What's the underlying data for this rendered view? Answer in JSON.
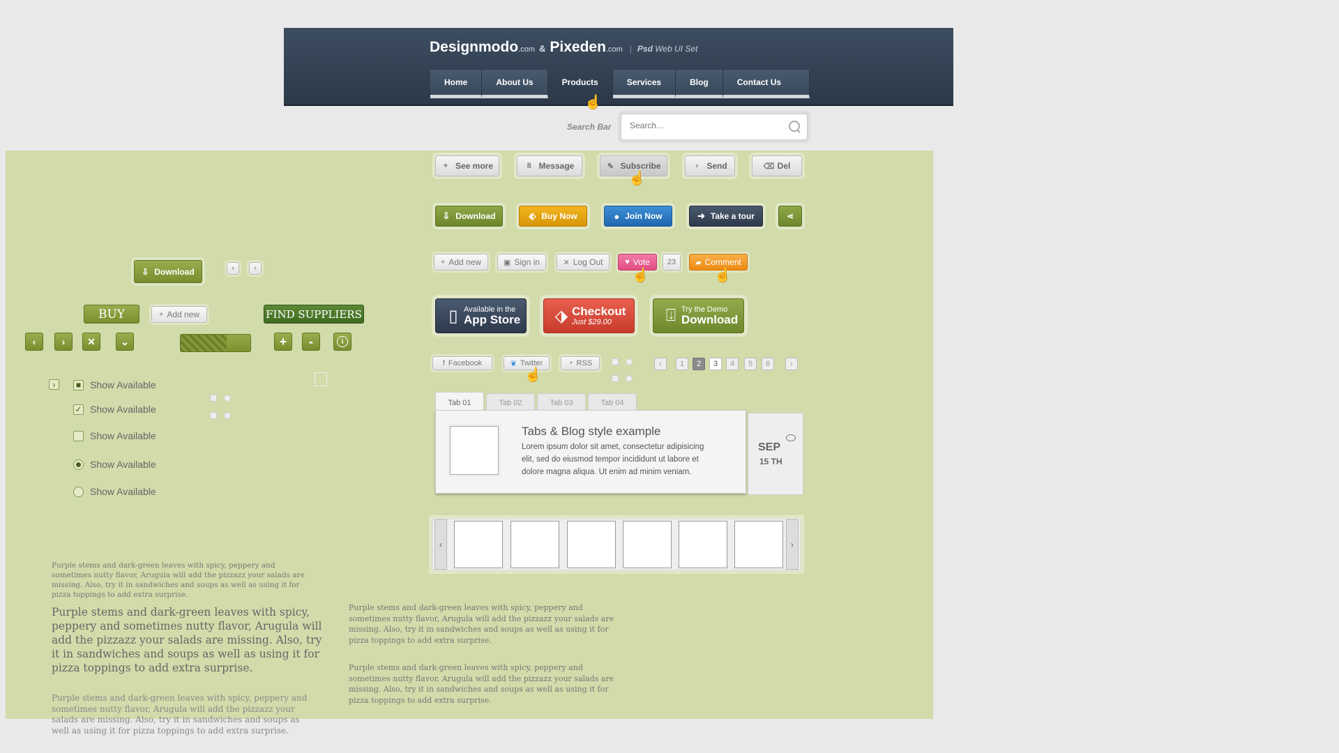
{
  "header": {
    "brand1": "Designmodo",
    "brand1_suffix": ".com",
    "amp": "&",
    "brand2": "Pixeden",
    "brand2_suffix": ".com",
    "divider": "|",
    "psd": "Psd",
    "subtitle": "Web UI Set",
    "nav": [
      "Home",
      "About Us",
      "Products",
      "Services",
      "Blog",
      "Contact Us"
    ],
    "active_nav": "Products"
  },
  "search": {
    "label": "Search Bar",
    "placeholder": "Search..."
  },
  "row1": [
    "See more",
    "Message",
    "Subscribe",
    "Send",
    "Del"
  ],
  "row1_badge": "8",
  "row2": [
    "Download",
    "Buy Now",
    "Join Now",
    "Take a tour"
  ],
  "row3": {
    "add": "Add new",
    "signin": "Sign in",
    "logout": "Log Out",
    "vote": "Vote",
    "count": "23",
    "comment": "Comment"
  },
  "big": {
    "appstore_l1": "Available in the",
    "appstore_l2": "App Store",
    "checkout_l1": "Checkout",
    "checkout_l2": "Just $29.00",
    "demo_l1": "Try the Demo",
    "demo_l2": "Download"
  },
  "social": [
    "Facebook",
    "Twitter",
    "RSS"
  ],
  "pager": {
    "prev": "‹",
    "next": "›",
    "pages": [
      "1",
      "2",
      "3",
      "4",
      "5",
      "6"
    ]
  },
  "tabs": [
    "Tab 01",
    "Tab 02",
    "Tab 03",
    "Tab 04"
  ],
  "blog": {
    "title": "Tabs & Blog style example",
    "text": "Lorem ipsum dolor sit amet, consectetur adipisicing elit, sed do eiusmod tempor incididunt ut labore et dolore magna aliqua. Ut enim ad minim veniam.",
    "month": "SEP",
    "day": "15 TH"
  },
  "left": {
    "download": "Download",
    "buy": "BUY",
    "add_new": "Add new",
    "find": "FIND SUPPLIERS",
    "plus": "+",
    "minus": "-",
    "info": "i",
    "checks": [
      "Show Available",
      "Show Available",
      "Show Available",
      "Show Available",
      "Show Available"
    ]
  },
  "paragraph": "Purple stems and dark-green leaves with spicy, peppery and sometimes nutty flavor, Arugula will add the pizzazz your salads are missing. Also, try it in sandwiches and soups as well as using it for pizza toppings to add extra surprise.",
  "colors": {
    "green_panel": "#d2dbaa",
    "header": "#34445a",
    "olive": "#8a9e3e",
    "orange": "#f39a1e",
    "blue": "#2f78c0",
    "pink": "#e85a8c",
    "red": "#d94a3e"
  }
}
